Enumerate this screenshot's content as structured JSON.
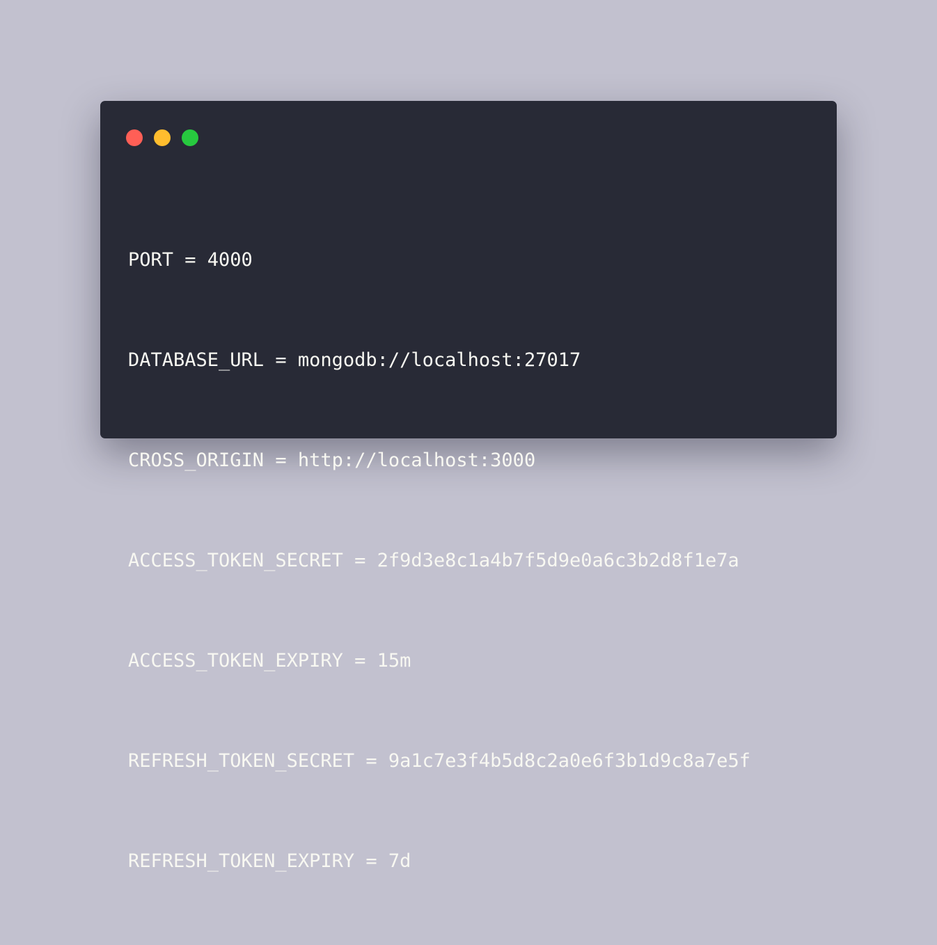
{
  "window": {
    "background": "#282a36",
    "controls": [
      {
        "name": "close",
        "icon": "red-traffic-light-dot",
        "color": "#ff5f56"
      },
      {
        "name": "minimize",
        "icon": "yellow-traffic-light-dot",
        "color": "#ffbd2e"
      },
      {
        "name": "maximize",
        "icon": "green-traffic-light-dot",
        "color": "#27c93f"
      }
    ]
  },
  "code": {
    "lines": [
      "PORT = 4000",
      "DATABASE_URL = mongodb://localhost:27017",
      "CROSS_ORIGIN = http://localhost:3000",
      "ACCESS_TOKEN_SECRET = 2f9d3e8c1a4b7f5d9e0a6c3b2d8f1e7a",
      "ACCESS_TOKEN_EXPIRY = 15m",
      "REFRESH_TOKEN_SECRET = 9a1c7e3f4b5d8c2a0e6f3b1d9c8a7e5f",
      "REFRESH_TOKEN_EXPIRY = 7d"
    ]
  }
}
